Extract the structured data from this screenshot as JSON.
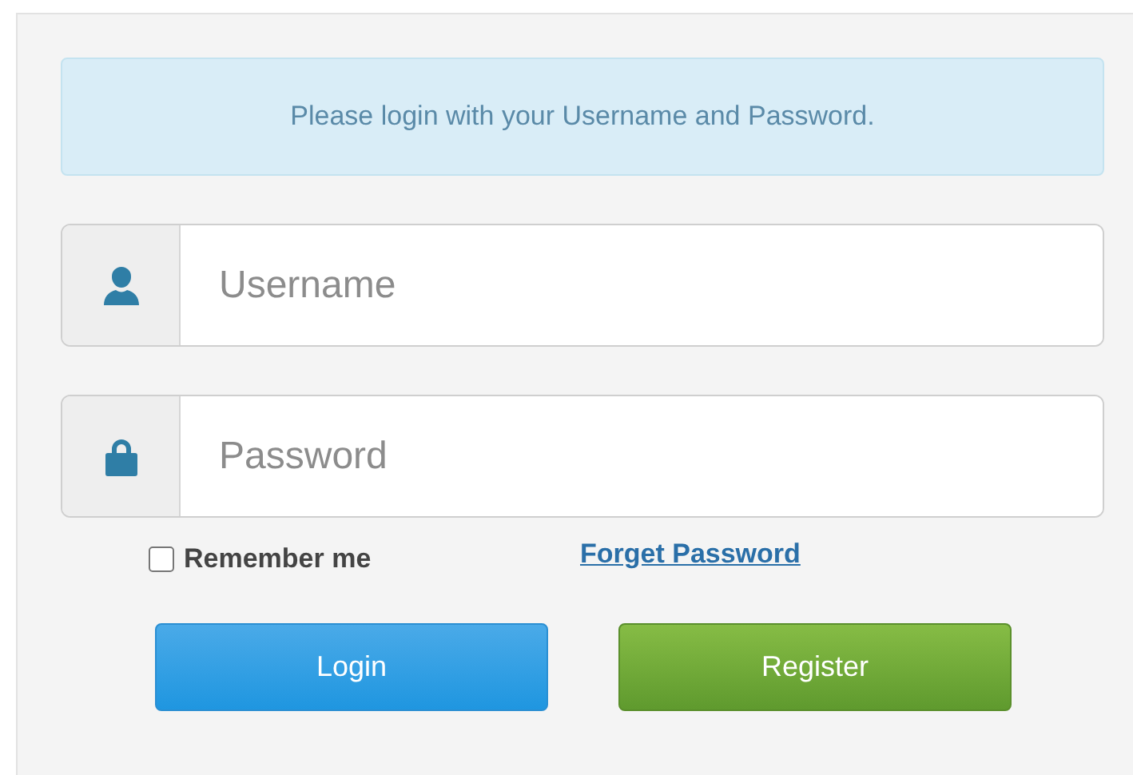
{
  "alert": {
    "text": "Please login with your Username and Password."
  },
  "fields": [
    {
      "kind": "user",
      "placeholder": "Username"
    },
    {
      "kind": "lock",
      "placeholder": "Password"
    }
  ],
  "remember": {
    "label": "Remember me",
    "checked": false
  },
  "forgot_link": "Forget Password",
  "buttons": [
    {
      "kind": "primary",
      "label": "Login"
    },
    {
      "kind": "success",
      "label": "Register"
    }
  ]
}
